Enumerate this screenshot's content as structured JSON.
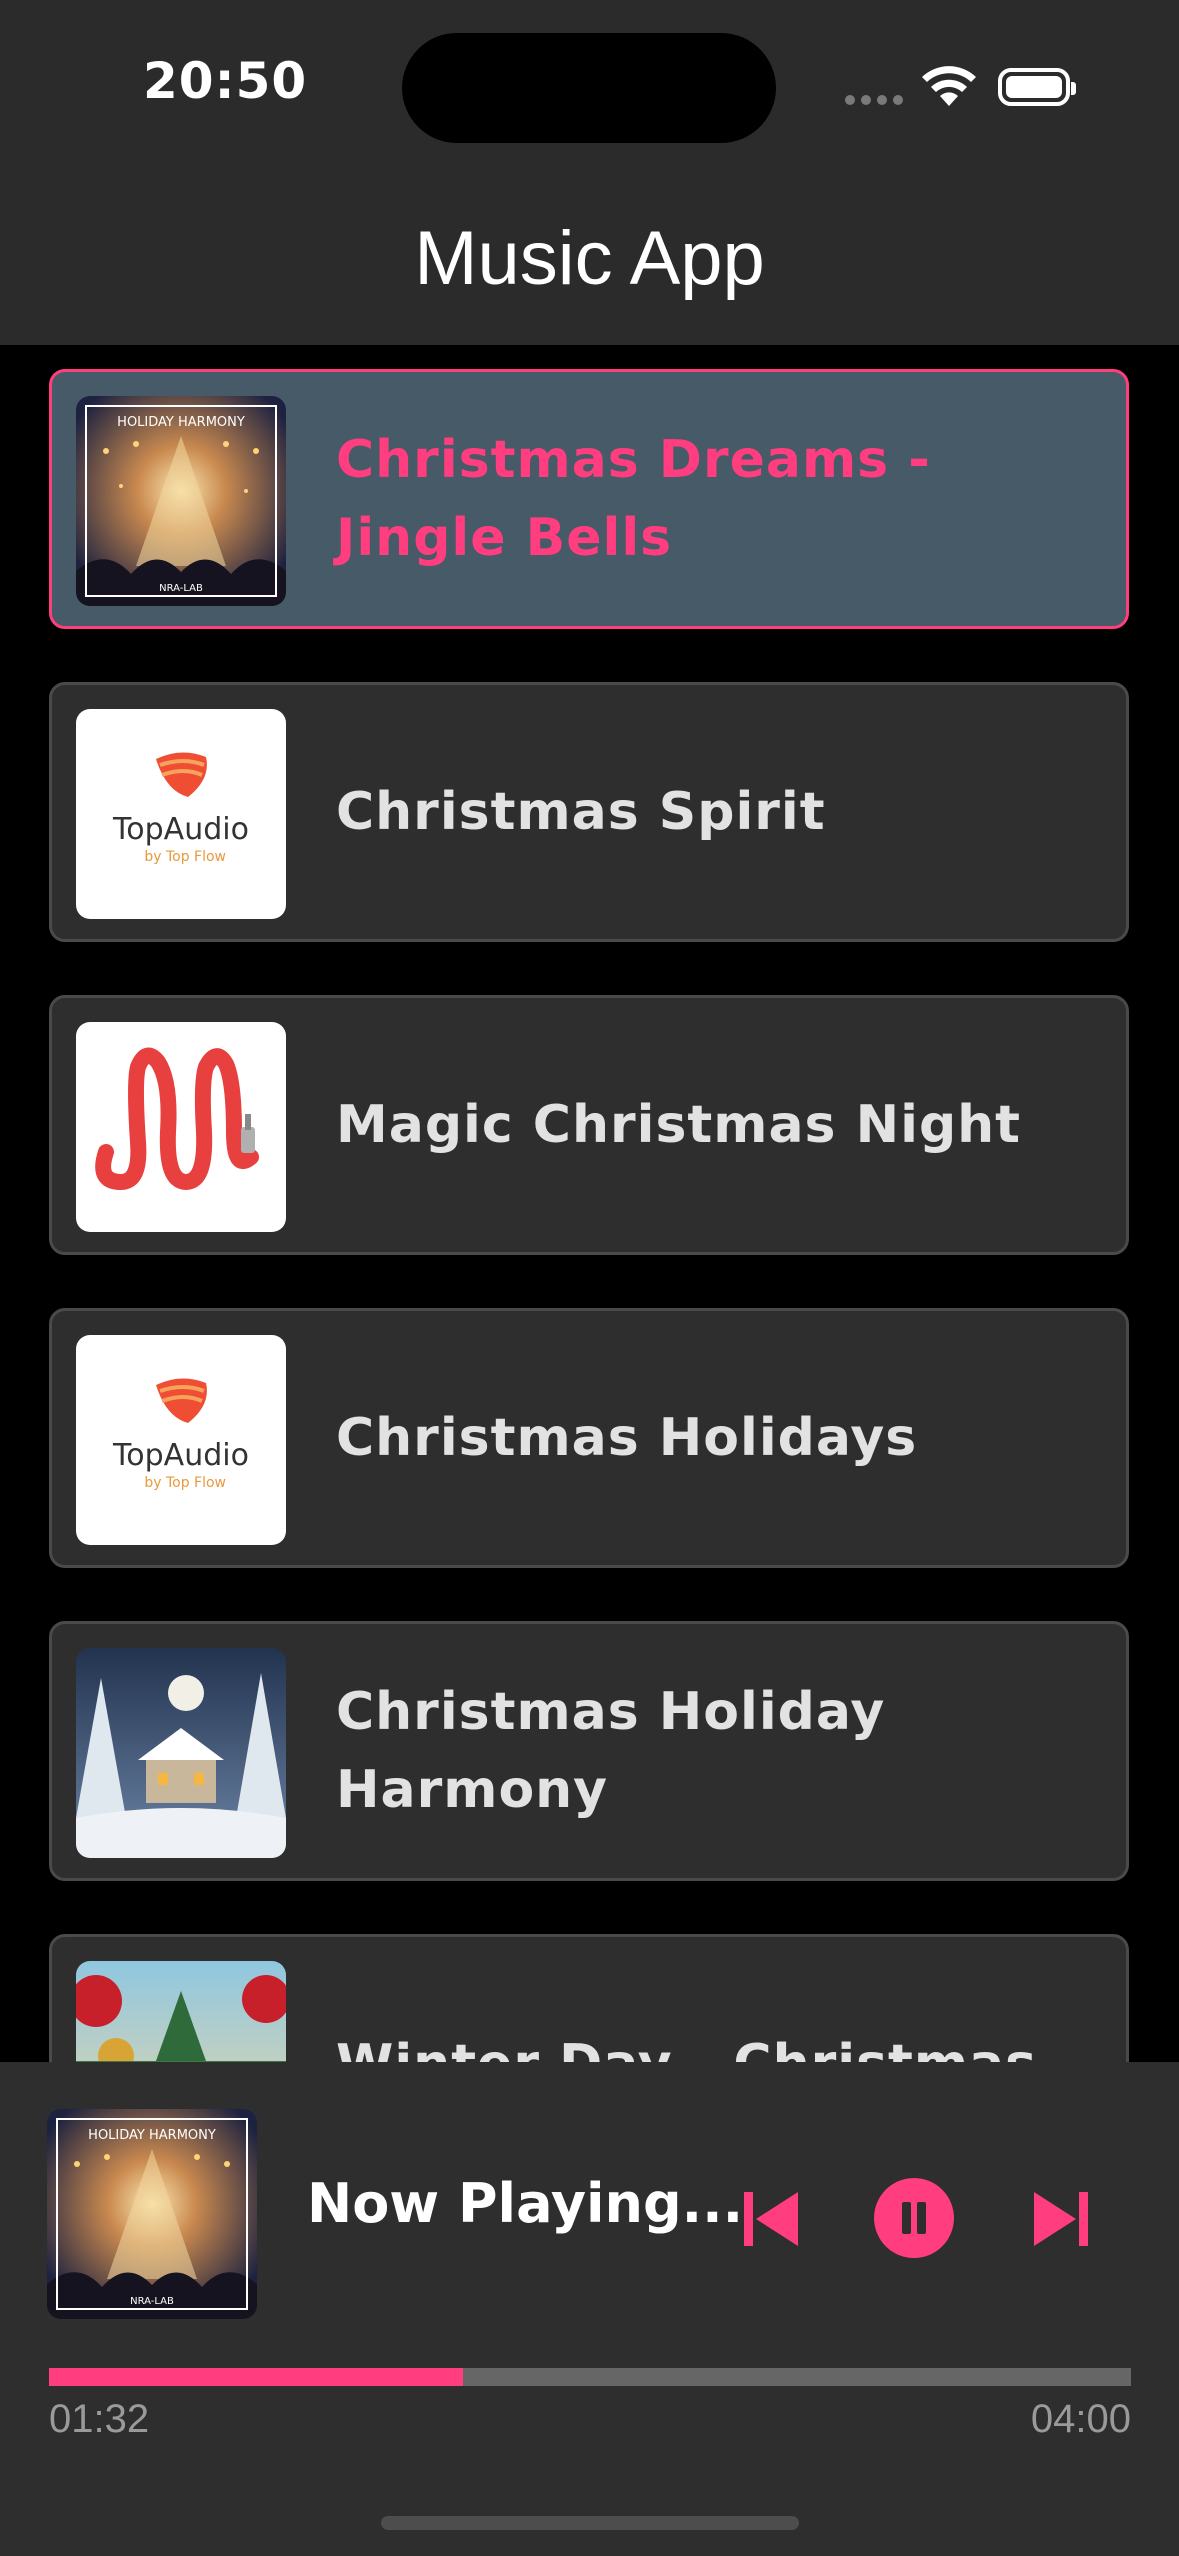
{
  "status_bar": {
    "time": "20:50"
  },
  "header": {
    "title": "Music App"
  },
  "tracks": [
    {
      "title": "Christmas Dreams - Jingle Bells",
      "artwork": "holiday-harmony",
      "active": true
    },
    {
      "title": "Christmas Spirit",
      "artwork": "topaudio-logo",
      "active": false
    },
    {
      "title": "Magic Christmas Night",
      "artwork": "m-cable-logo",
      "active": false
    },
    {
      "title": "Christmas Holidays",
      "artwork": "topaudio-logo",
      "active": false
    },
    {
      "title": "Christmas Holiday Harmony",
      "artwork": "snowy-village",
      "active": false
    },
    {
      "title": "Winter Day - Christmas",
      "artwork": "christmas-ornaments",
      "active": false
    }
  ],
  "artwork_text": {
    "holiday_harmony": "HOLIDAY HARMONY",
    "nra_lab": "NRA-LAB",
    "topaudio": "TopAudio",
    "topaudio_sub": "by Top Flow"
  },
  "player": {
    "now_playing": "Now Playing...",
    "elapsed": "01:32",
    "duration": "04:00",
    "progress": 0.383,
    "controls": {
      "previous": "skip-previous-icon",
      "pause": "pause-icon",
      "next": "skip-next-icon"
    }
  },
  "colors": {
    "accent": "#ff3d7f",
    "active_row": "#475a67",
    "row": "#2e2e2e",
    "background": "#000000",
    "header": "#2b2b2b"
  }
}
